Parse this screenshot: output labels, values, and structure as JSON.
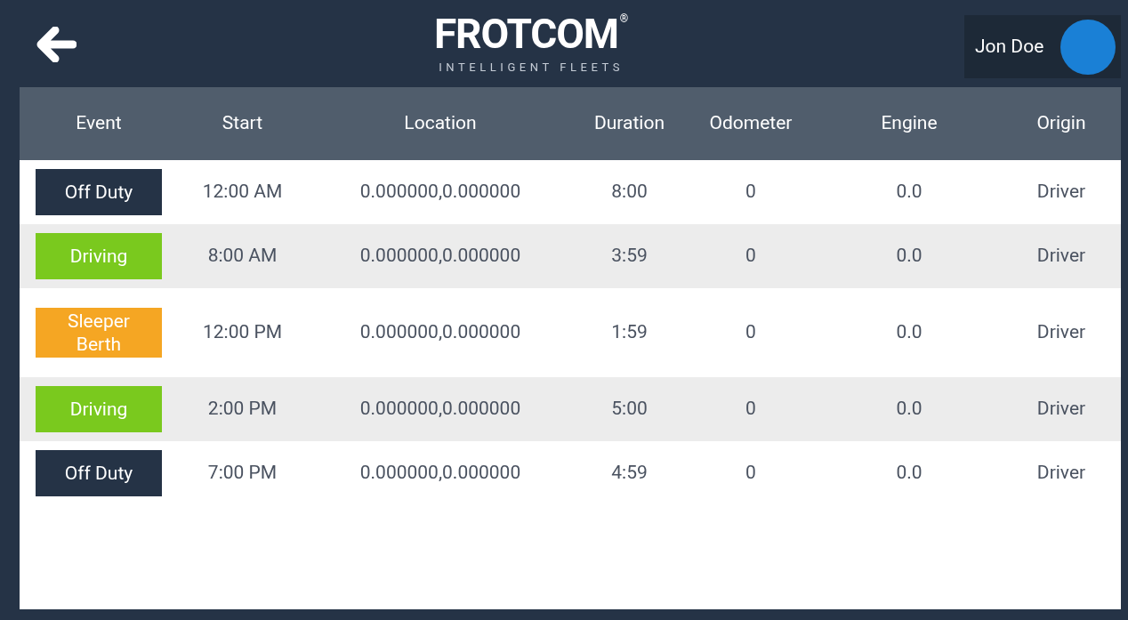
{
  "header": {
    "logo": {
      "name": "FROTCOM",
      "mark": "®",
      "tagline": "INTELLIGENT FLEETS"
    },
    "user": {
      "name": "Jon Doe"
    }
  },
  "table": {
    "columns": [
      "Event",
      "Start",
      "Location",
      "Duration",
      "Odometer",
      "Engine",
      "Origin"
    ],
    "rows": [
      {
        "event": {
          "label": "Off Duty",
          "color": "#253346"
        },
        "start": "12:00 AM",
        "location": "0.000000,0.000000",
        "duration": "8:00",
        "odometer": "0",
        "engine": "0.0",
        "origin": "Driver"
      },
      {
        "event": {
          "label": "Driving",
          "color": "#7ac91e"
        },
        "start": "8:00 AM",
        "location": "0.000000,0.000000",
        "duration": "3:59",
        "odometer": "0",
        "engine": "0.0",
        "origin": "Driver"
      },
      {
        "event": {
          "label": "Sleeper Berth",
          "color": "#f5a623"
        },
        "start": "12:00 PM",
        "location": "0.000000,0.000000",
        "duration": "1:59",
        "odometer": "0",
        "engine": "0.0",
        "origin": "Driver"
      },
      {
        "event": {
          "label": "Driving",
          "color": "#7ac91e"
        },
        "start": "2:00 PM",
        "location": "0.000000,0.000000",
        "duration": "5:00",
        "odometer": "0",
        "engine": "0.0",
        "origin": "Driver"
      },
      {
        "event": {
          "label": "Off Duty",
          "color": "#253346"
        },
        "start": "7:00 PM",
        "location": "0.000000,0.000000",
        "duration": "4:59",
        "odometer": "0",
        "engine": "0.0",
        "origin": "Driver"
      }
    ]
  }
}
